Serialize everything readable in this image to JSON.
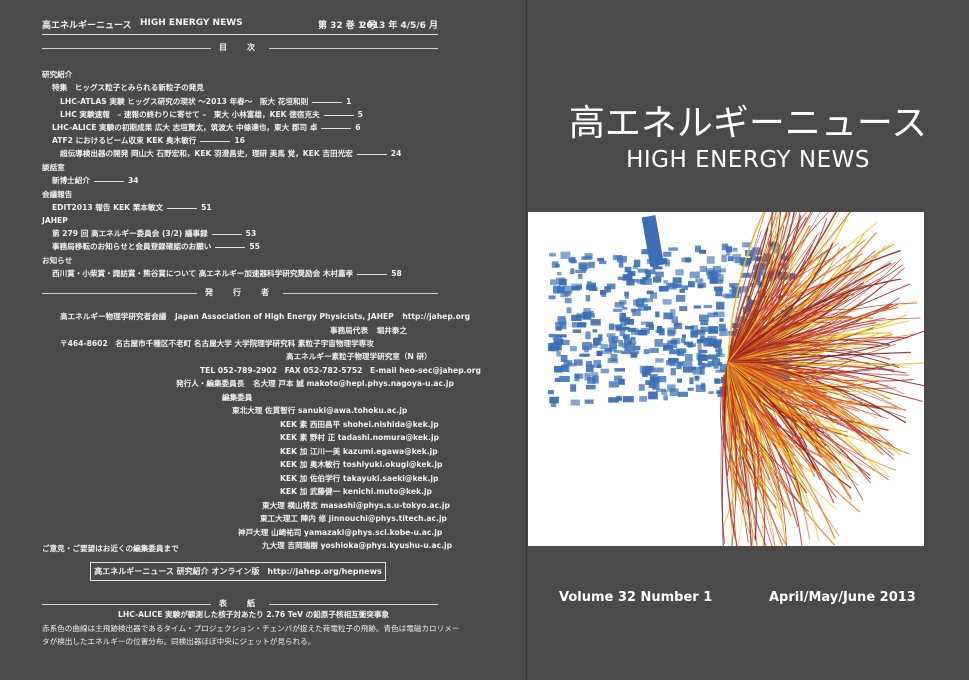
{
  "header": {
    "journal_jp": "高エネルギーニュース",
    "journal_en": "HIGH ENERGY NEWS",
    "volume": "第 32 巻 1 号",
    "date": "2013 年 4/5/6 月"
  },
  "contents": {
    "heading": "目　次",
    "lines": [
      {
        "text": "研究紹介",
        "page": ""
      },
      {
        "text": "特集　ヒッグス粒子とみられる新粒子の発見",
        "page": ""
      },
      {
        "text": "LHC-ATLAS 実験 ヒッグス研究の現状 ～2013 年春～　阪大 花垣和則",
        "page": "1"
      },
      {
        "text": "LHC 実験速報　– 速報の終わりに寄せて –　東大 小林富雄，KEK 徳宿克夫",
        "page": "5"
      },
      {
        "text": "LHC-ALICE 実験の初期成果 広大 志垣賢太，筑波大 中條達也，東大 郡司 卓",
        "page": "6"
      },
      {
        "text": "ATF2 におけるビーム収束 KEK 奥木敏行",
        "page": "16"
      },
      {
        "text": "超伝導検出器の開発 岡山大 石野宏和，KEK 羽澄昌史，理研 美馬 覚，KEK 吉田光宏",
        "page": "24"
      },
      {
        "text": "談話室",
        "page": ""
      },
      {
        "text": "新博士紹介",
        "page": "34"
      },
      {
        "text": "会議報告",
        "page": ""
      },
      {
        "text": "EDIT2013 報告 KEK 栗本敏文",
        "page": "51"
      },
      {
        "text": "JAHEP",
        "page": ""
      },
      {
        "text": "第 279 回 高エネルギー委員会 (3/2) 議事録",
        "page": "53"
      },
      {
        "text": "事務局移転のお知らせと会員登録確認のお願い",
        "page": "55"
      },
      {
        "text": "お知らせ",
        "page": ""
      },
      {
        "text": "西川賞・小柴賞・諏訪賞・熊谷賞について 高エネルギー加速器科学研究奨励会 木村嘉孝",
        "page": "58"
      }
    ]
  },
  "publisher": {
    "heading": "発　行　者",
    "org_jp": "高エネルギー物理学研究者会議",
    "org_en": "Japan Association of High Energy Physicists, JAHEP",
    "url": "http://jahep.org",
    "rep_label": "事務局代表",
    "rep_name": "堀井泰之",
    "address": "〒464-8602　名古屋市千種区不老町 名古屋大学 大学院理学研究科 素粒子宇宙物理学専攻",
    "address2": "高エネルギー素粒子物理学研究室（N 研）",
    "tel": "TEL 052-789-2902　FAX 052-782-5752　E-mail heo-sec@jahep.org",
    "editor_label": "発行人・編集委員長",
    "editor": "名大理 戸本 誠 makoto@hepl.phys.nagoya-u.ac.jp",
    "committee_label": "編集委員",
    "members": [
      "東北大理 佐貫智行 sanuki@awa.tohoku.ac.jp",
      "KEK 素 西田昌平 shohei.nishida@kek.jp",
      "KEK 素 野村 正 tadashi.nomura@kek.jp",
      "KEK 加 江川一美 kazumi.egawa@kek.jp",
      "KEK 加 奥木敏行 toshiyuki.okugi@kek.jp",
      "KEK 加 佐伯学行 takayuki.saeki@kek.jp",
      "KEK 加 武藤健一 kenichi.muto@kek.jp",
      "東大理 横山将志 masashi@phys.s.u-tokyo.ac.jp",
      "東工大理工 陣内 修 jinnouchi@phys.titech.ac.jp",
      "神戸大理 山崎祐司 yamazaki@phys.sci.kobe-u.ac.jp",
      "九大理 吉岡瑞樹 yoshioka@phys.kyushu-u.ac.jp"
    ],
    "note": "ご意見・ご要望はお近くの編集委員まで",
    "online": "高エネルギーニュース 研究紹介 オンライン版　http://jahep.org/hepnews"
  },
  "cover": {
    "heading": "表　紙",
    "caption_title": "LHC-ALICE 実験が観測した核子対あたり 2.76 TeV の鉛原子核相互衝突事象",
    "caption_1": "赤系色の曲線は主飛跡検出器であるタイム・プロジェクション・チェンバが捉えた荷電粒子の飛跡。青色は電磁カロリメー",
    "caption_2": "タが検出したエネルギーの位置分布。同検出器ほぼ中央にジェットが見られる。"
  },
  "right": {
    "title_jp": "高エネルギーニュース",
    "title_en": "HIGH ENERGY NEWS",
    "volume": "Volume 32 Number 1",
    "date": "April/May/June 2013"
  },
  "colors": {
    "background": "#4a4a4a",
    "text": "#f2f2f2",
    "track_red": "#c0392b",
    "track_orange": "#e67e22",
    "track_yellow": "#f1c40f",
    "calorimeter_blue": "#3a6fb5"
  }
}
